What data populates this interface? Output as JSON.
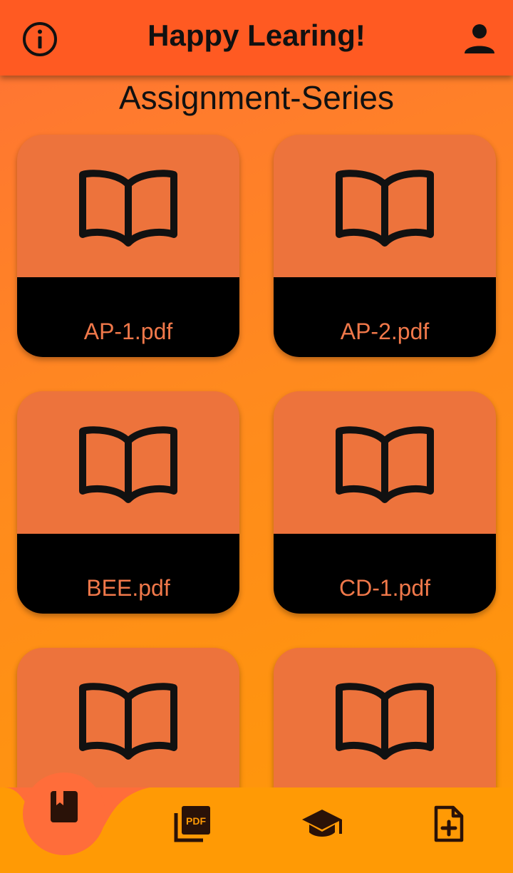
{
  "appbar": {
    "title": "Happy Learing!",
    "info_icon": "info-icon",
    "profile_icon": "person-icon"
  },
  "page": {
    "heading": "Assignment-Series"
  },
  "files": [
    {
      "name": "AP-1.pdf",
      "icon": "book-open-icon"
    },
    {
      "name": "AP-2.pdf",
      "icon": "book-open-icon"
    },
    {
      "name": "BEE.pdf",
      "icon": "book-open-icon"
    },
    {
      "name": "CD-1.pdf",
      "icon": "book-open-icon"
    },
    {
      "name": "",
      "icon": "book-open-icon"
    },
    {
      "name": "",
      "icon": "book-open-icon"
    }
  ],
  "bottom_nav": {
    "active_index": 0,
    "items": [
      {
        "icon": "bookmark-book-icon",
        "active": true
      },
      {
        "icon": "pdf-icon",
        "active": false
      },
      {
        "icon": "graduation-cap-icon",
        "active": false
      },
      {
        "icon": "add-file-icon",
        "active": false
      }
    ]
  },
  "colors": {
    "appbar": "#ff5a22",
    "card": "#ed733c",
    "card_footer": "#000000",
    "file_label": "#f0784a",
    "bottom_nav": "#ff9a05",
    "nav_active_bump": "#ff6d3a"
  }
}
